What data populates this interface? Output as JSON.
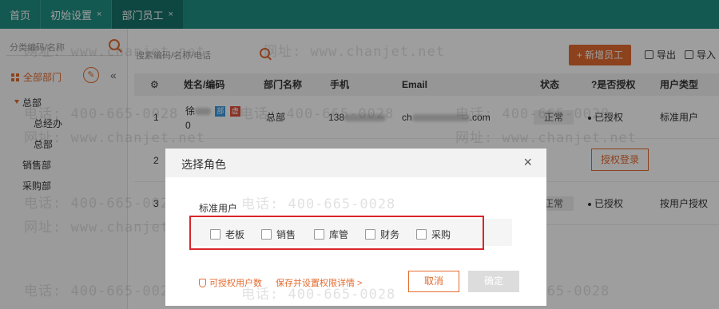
{
  "top_tabs": [
    {
      "label": "首页",
      "closable": false
    },
    {
      "label": "初始设置",
      "closable": true
    },
    {
      "label": "部门员工",
      "closable": true
    }
  ],
  "close_glyph": "×",
  "left_panel": {
    "search_placeholder": "分类编码/名称",
    "all_departments": "全部部门",
    "edit_glyph": "✎",
    "collapse_glyph": "«",
    "tree": [
      {
        "label": "总部",
        "level": 0,
        "expanded": true
      },
      {
        "label": "总经办",
        "level": 1
      },
      {
        "label": "总部",
        "level": 1
      },
      {
        "label": "销售部",
        "level": 0
      },
      {
        "label": "采购部",
        "level": 0
      }
    ]
  },
  "toolbar": {
    "search_placeholder": "搜索编码/名称/电话",
    "add_label": "+ 新增员工",
    "export_label": "导出",
    "import_label": "导入"
  },
  "table": {
    "columns": [
      "⚙",
      "姓名/编码",
      "部门名称",
      "手机",
      "Email",
      "状态",
      "?是否授权",
      "用户类型"
    ],
    "rows": [
      {
        "index": "1",
        "name": "徐",
        "code": "0",
        "badges": [
          "部",
          "虚"
        ],
        "dept": "总部",
        "phone": "138",
        "email_prefix": "ch",
        "email_suffix": ".com",
        "status": "正常",
        "auth": "已授权",
        "user_type": "标准用户"
      },
      {
        "index": "2",
        "name": "",
        "code": "",
        "dept": "",
        "phone": "",
        "email_prefix": "",
        "email_suffix": "",
        "status": "",
        "auth_button": "授权登录",
        "user_type": ""
      },
      {
        "index": "3",
        "name": "",
        "code": "",
        "dept": "",
        "phone": "",
        "email_prefix": "",
        "email_suffix": "",
        "status": "正常",
        "auth": "已授权",
        "user_type": "按用户授权"
      }
    ]
  },
  "watermark": {
    "phone": "电话: 400-665-0028",
    "site": "网址: www.chanjet.net"
  },
  "modal": {
    "title": "选择角色",
    "close_glyph": "×",
    "section_label": "标准用户",
    "roles": [
      "老板",
      "销售",
      "库管",
      "财务",
      "采购"
    ],
    "footer_link_1": "可授权用户数",
    "footer_link_2": "保存并设置权限详情 >",
    "cancel_label": "取消",
    "confirm_label": "确定"
  },
  "colors": {
    "brand": "#1f8f84",
    "accent": "#e36b2f",
    "highlight": "#d9262b"
  }
}
